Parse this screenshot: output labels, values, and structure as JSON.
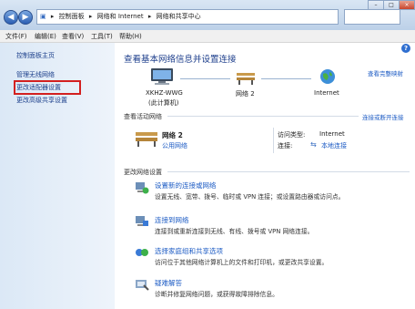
{
  "breadcrumb": {
    "parts": [
      "控制面板",
      "网络和 Internet",
      "网络和共享中心"
    ],
    "separator": "▸"
  },
  "menu": [
    "文件(F)",
    "编辑(E)",
    "查看(V)",
    "工具(T)",
    "帮助(H)"
  ],
  "sidebar": {
    "items": [
      {
        "label": "控制面板主页"
      },
      {
        "label": "管理无线网络"
      },
      {
        "label": "更改适配器设置"
      },
      {
        "label": "更改高级共享设置"
      }
    ]
  },
  "main": {
    "heading": "查看基本网络信息并设置连接",
    "view_full_map": "查看完整映射",
    "map": {
      "computer_name": "XKHZ-WWG",
      "computer_sub": "(此计算机)",
      "network": "网络 2",
      "internet": "Internet"
    },
    "active_networks_title": "查看活动网络",
    "connect_disconnect": "连接或断开连接",
    "network_name": "网络 2",
    "network_type": "公用网络",
    "access_type_label": "访问类型:",
    "access_type_value": "Internet",
    "connections_label": "连接:",
    "connections_value": "本地连接",
    "change_settings_title": "更改网络设置",
    "tasks": [
      {
        "title": "设置新的连接或网络",
        "desc": "设置无线、宽带、拨号、临时或 VPN 连接；或设置路由器或访问点。"
      },
      {
        "title": "连接到网络",
        "desc": "连接到或重新连接到无线、有线、拨号或 VPN 网络连接。"
      },
      {
        "title": "选择家庭组和共享选项",
        "desc": "访问位于其他网络计算机上的文件和打印机，或更改共享设置。"
      },
      {
        "title": "疑难解答",
        "desc": "诊断并修复网络问题，或获得故障排除信息。"
      }
    ]
  },
  "window_buttons": [
    "–",
    "□",
    "×"
  ],
  "colors": {
    "accent_link": "#1c5bc4",
    "highlight_box": "#d32020",
    "heading": "#1e3f8c"
  }
}
